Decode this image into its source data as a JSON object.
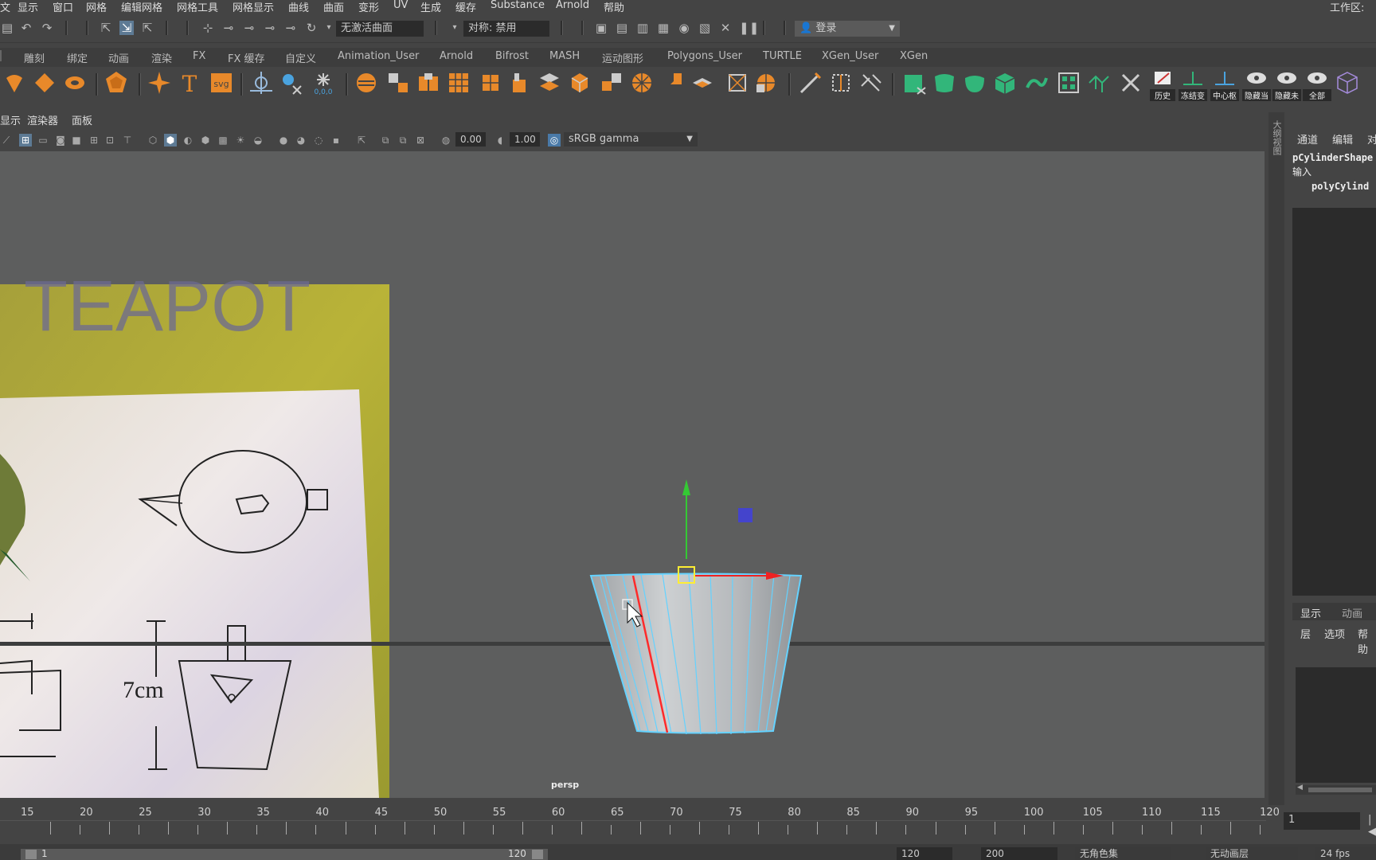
{
  "menubar": {
    "items": [
      "文",
      "显示",
      "窗口",
      "网格",
      "编辑网格",
      "网格工具",
      "网格显示",
      "曲线",
      "曲面",
      "变形",
      "UV",
      "生成",
      "缓存",
      "Substance",
      "Arnold",
      "帮助"
    ],
    "workspace_label": "工作区:"
  },
  "statusline": {
    "live_surface": "无激活曲面",
    "symmetry": "对称: 禁用",
    "login": "登录"
  },
  "shelf_tabs": [
    "雕刻",
    "绑定",
    "动画",
    "渲染",
    "FX",
    "FX 缓存",
    "自定义",
    "Animation_User",
    "Arnold",
    "Bifrost",
    "MASH",
    "运动图形",
    "Polygons_User",
    "TURTLE",
    "XGen_User",
    "XGen"
  ],
  "shelf_labels": [
    "历史",
    "冻结变",
    "中心枢",
    "隐藏当",
    "隐藏未",
    "全部"
  ],
  "viewport": {
    "menu": [
      "显示",
      "渲染器",
      "面板"
    ],
    "exposure": "0.00",
    "gamma": "1.00",
    "color_space": "sRGB gamma",
    "camera_name": "persp",
    "ref_image": {
      "title": "TEAPOT",
      "dimension_label": "7cm"
    }
  },
  "right_panel": {
    "vertical_label": "大纲视图",
    "tabs": [
      "通道",
      "编辑",
      "对"
    ],
    "object_name": "pCylinderShape",
    "inputs_label": "输入",
    "input_node": "polyCylind",
    "layer_tabs": [
      "显示",
      "动画"
    ],
    "layer_menu": [
      "层",
      "选项",
      "帮助"
    ]
  },
  "timeline": {
    "labels": [
      "15",
      "20",
      "25",
      "30",
      "35",
      "40",
      "45",
      "50",
      "55",
      "60",
      "65",
      "70",
      "75",
      "80",
      "85",
      "90",
      "95",
      "100",
      "105",
      "110",
      "115",
      "120"
    ],
    "current_frame": "1"
  },
  "range_bar": {
    "start": "1",
    "range_end": "120",
    "end_frame": "120",
    "max_frame": "200",
    "character_set": "无角色集",
    "anim_layer": "无动画层",
    "fps": "24 fps"
  },
  "colors": {
    "panel_bg": "#444444",
    "viewport_bg": "#5d5e5e",
    "shelf_orange": "#e8892a",
    "shelf_green": "#32b67a",
    "selection_cyan": "#64d2ff"
  }
}
